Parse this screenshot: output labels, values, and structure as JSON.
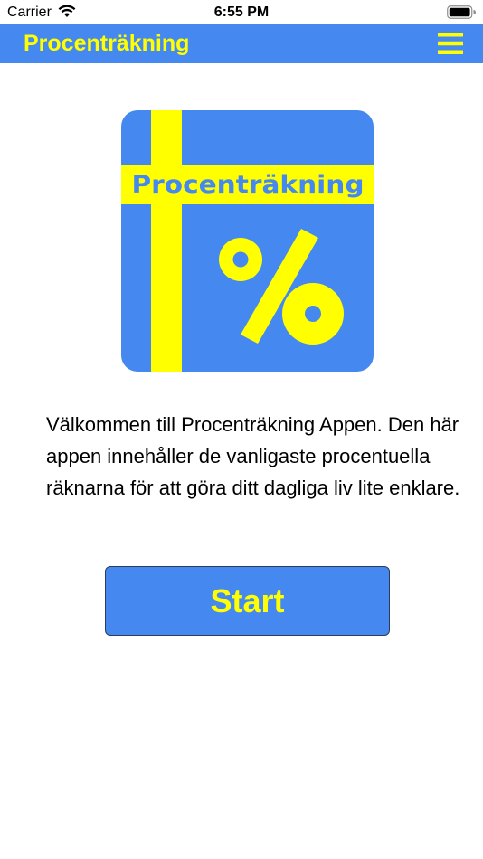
{
  "status_bar": {
    "carrier": "Carrier",
    "time": "6:55 PM",
    "wifi_icon": "wifi-icon",
    "battery_icon": "battery-icon"
  },
  "nav": {
    "title": "Procenträkning",
    "menu_icon": "hamburger-menu-icon"
  },
  "logo": {
    "text": "Procenträkning",
    "symbol": "%"
  },
  "welcome": {
    "text": "Välkommen till Procenträkning Appen. Den här appen innehåller de vanligaste procentuella räknarna för att göra ditt dagliga liv lite enklare."
  },
  "start_button": {
    "label": "Start"
  },
  "colors": {
    "brand_blue": "#4488f0",
    "brand_yellow": "#ffff00",
    "button_border": "#2a3d5a"
  }
}
